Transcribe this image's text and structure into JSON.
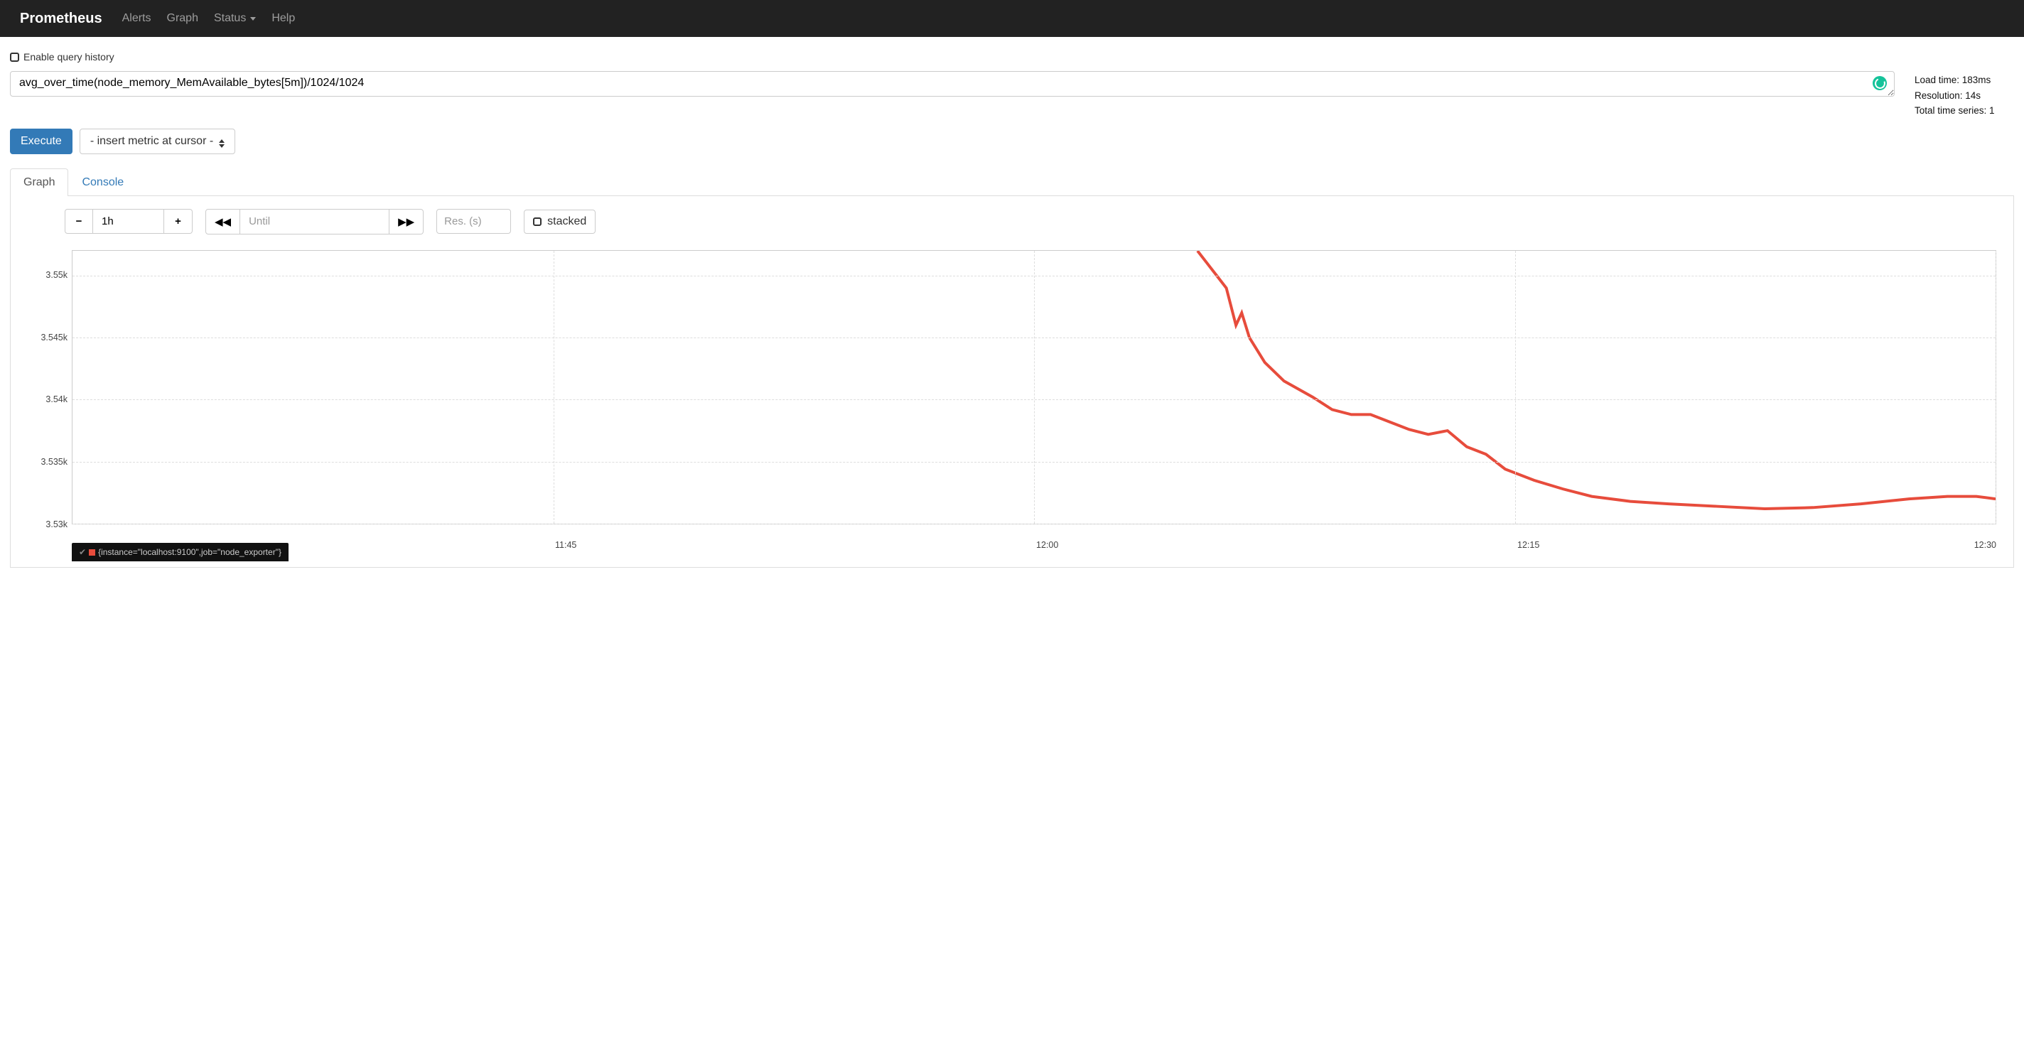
{
  "nav": {
    "brand": "Prometheus",
    "items": [
      "Alerts",
      "Graph",
      "Status",
      "Help"
    ],
    "status_has_dropdown": true
  },
  "enable_history_label": "Enable query history",
  "query": "avg_over_time(node_memory_MemAvailable_bytes[5m])/1024/1024",
  "stats": {
    "load_time": "Load time: 183ms",
    "resolution": "Resolution: 14s",
    "total_series": "Total time series: 1"
  },
  "buttons": {
    "execute": "Execute",
    "metric_select": "- insert metric at cursor -"
  },
  "tabs": {
    "graph": "Graph",
    "console": "Console"
  },
  "controls": {
    "range": "1h",
    "until_placeholder": "Until",
    "res_placeholder": "Res. (s)",
    "stacked_label": "stacked"
  },
  "chart_data": {
    "type": "line",
    "xlabel": "",
    "ylabel": "",
    "ylim": [
      3.53,
      3.552
    ],
    "y_ticks": [
      3.53,
      3.535,
      3.54,
      3.545,
      3.55
    ],
    "y_tick_labels": [
      "3.53k",
      "3.535k",
      "3.54k",
      "3.545k",
      "3.55k"
    ],
    "x_range": [
      "11:30",
      "12:30"
    ],
    "x_ticks": [
      0.25,
      0.5,
      0.75,
      1.0
    ],
    "x_tick_labels": [
      "11:45",
      "12:00",
      "12:15",
      "12:30"
    ],
    "series": [
      {
        "name": "{instance=\"localhost:9100\",job=\"node_exporter\"}",
        "color": "#e74c3c",
        "points": [
          [
            0.585,
            3.552
          ],
          [
            0.59,
            3.551
          ],
          [
            0.595,
            3.55
          ],
          [
            0.6,
            3.549
          ],
          [
            0.605,
            3.546
          ],
          [
            0.608,
            3.547
          ],
          [
            0.612,
            3.545
          ],
          [
            0.62,
            3.543
          ],
          [
            0.63,
            3.5415
          ],
          [
            0.645,
            3.5402
          ],
          [
            0.655,
            3.5392
          ],
          [
            0.665,
            3.5388
          ],
          [
            0.675,
            3.5388
          ],
          [
            0.685,
            3.5382
          ],
          [
            0.695,
            3.5376
          ],
          [
            0.705,
            3.5372
          ],
          [
            0.715,
            3.5375
          ],
          [
            0.725,
            3.5362
          ],
          [
            0.735,
            3.5356
          ],
          [
            0.745,
            3.5344
          ],
          [
            0.76,
            3.5335
          ],
          [
            0.775,
            3.5328
          ],
          [
            0.79,
            3.5322
          ],
          [
            0.81,
            3.5318
          ],
          [
            0.83,
            3.5316
          ],
          [
            0.855,
            3.5314
          ],
          [
            0.88,
            3.5312
          ],
          [
            0.905,
            3.5313
          ],
          [
            0.93,
            3.5316
          ],
          [
            0.955,
            3.532
          ],
          [
            0.975,
            3.5322
          ],
          [
            0.99,
            3.5322
          ],
          [
            1.0,
            3.532
          ]
        ]
      }
    ]
  },
  "legend": {
    "text": "{instance=\"localhost:9100\",job=\"node_exporter\"}"
  }
}
